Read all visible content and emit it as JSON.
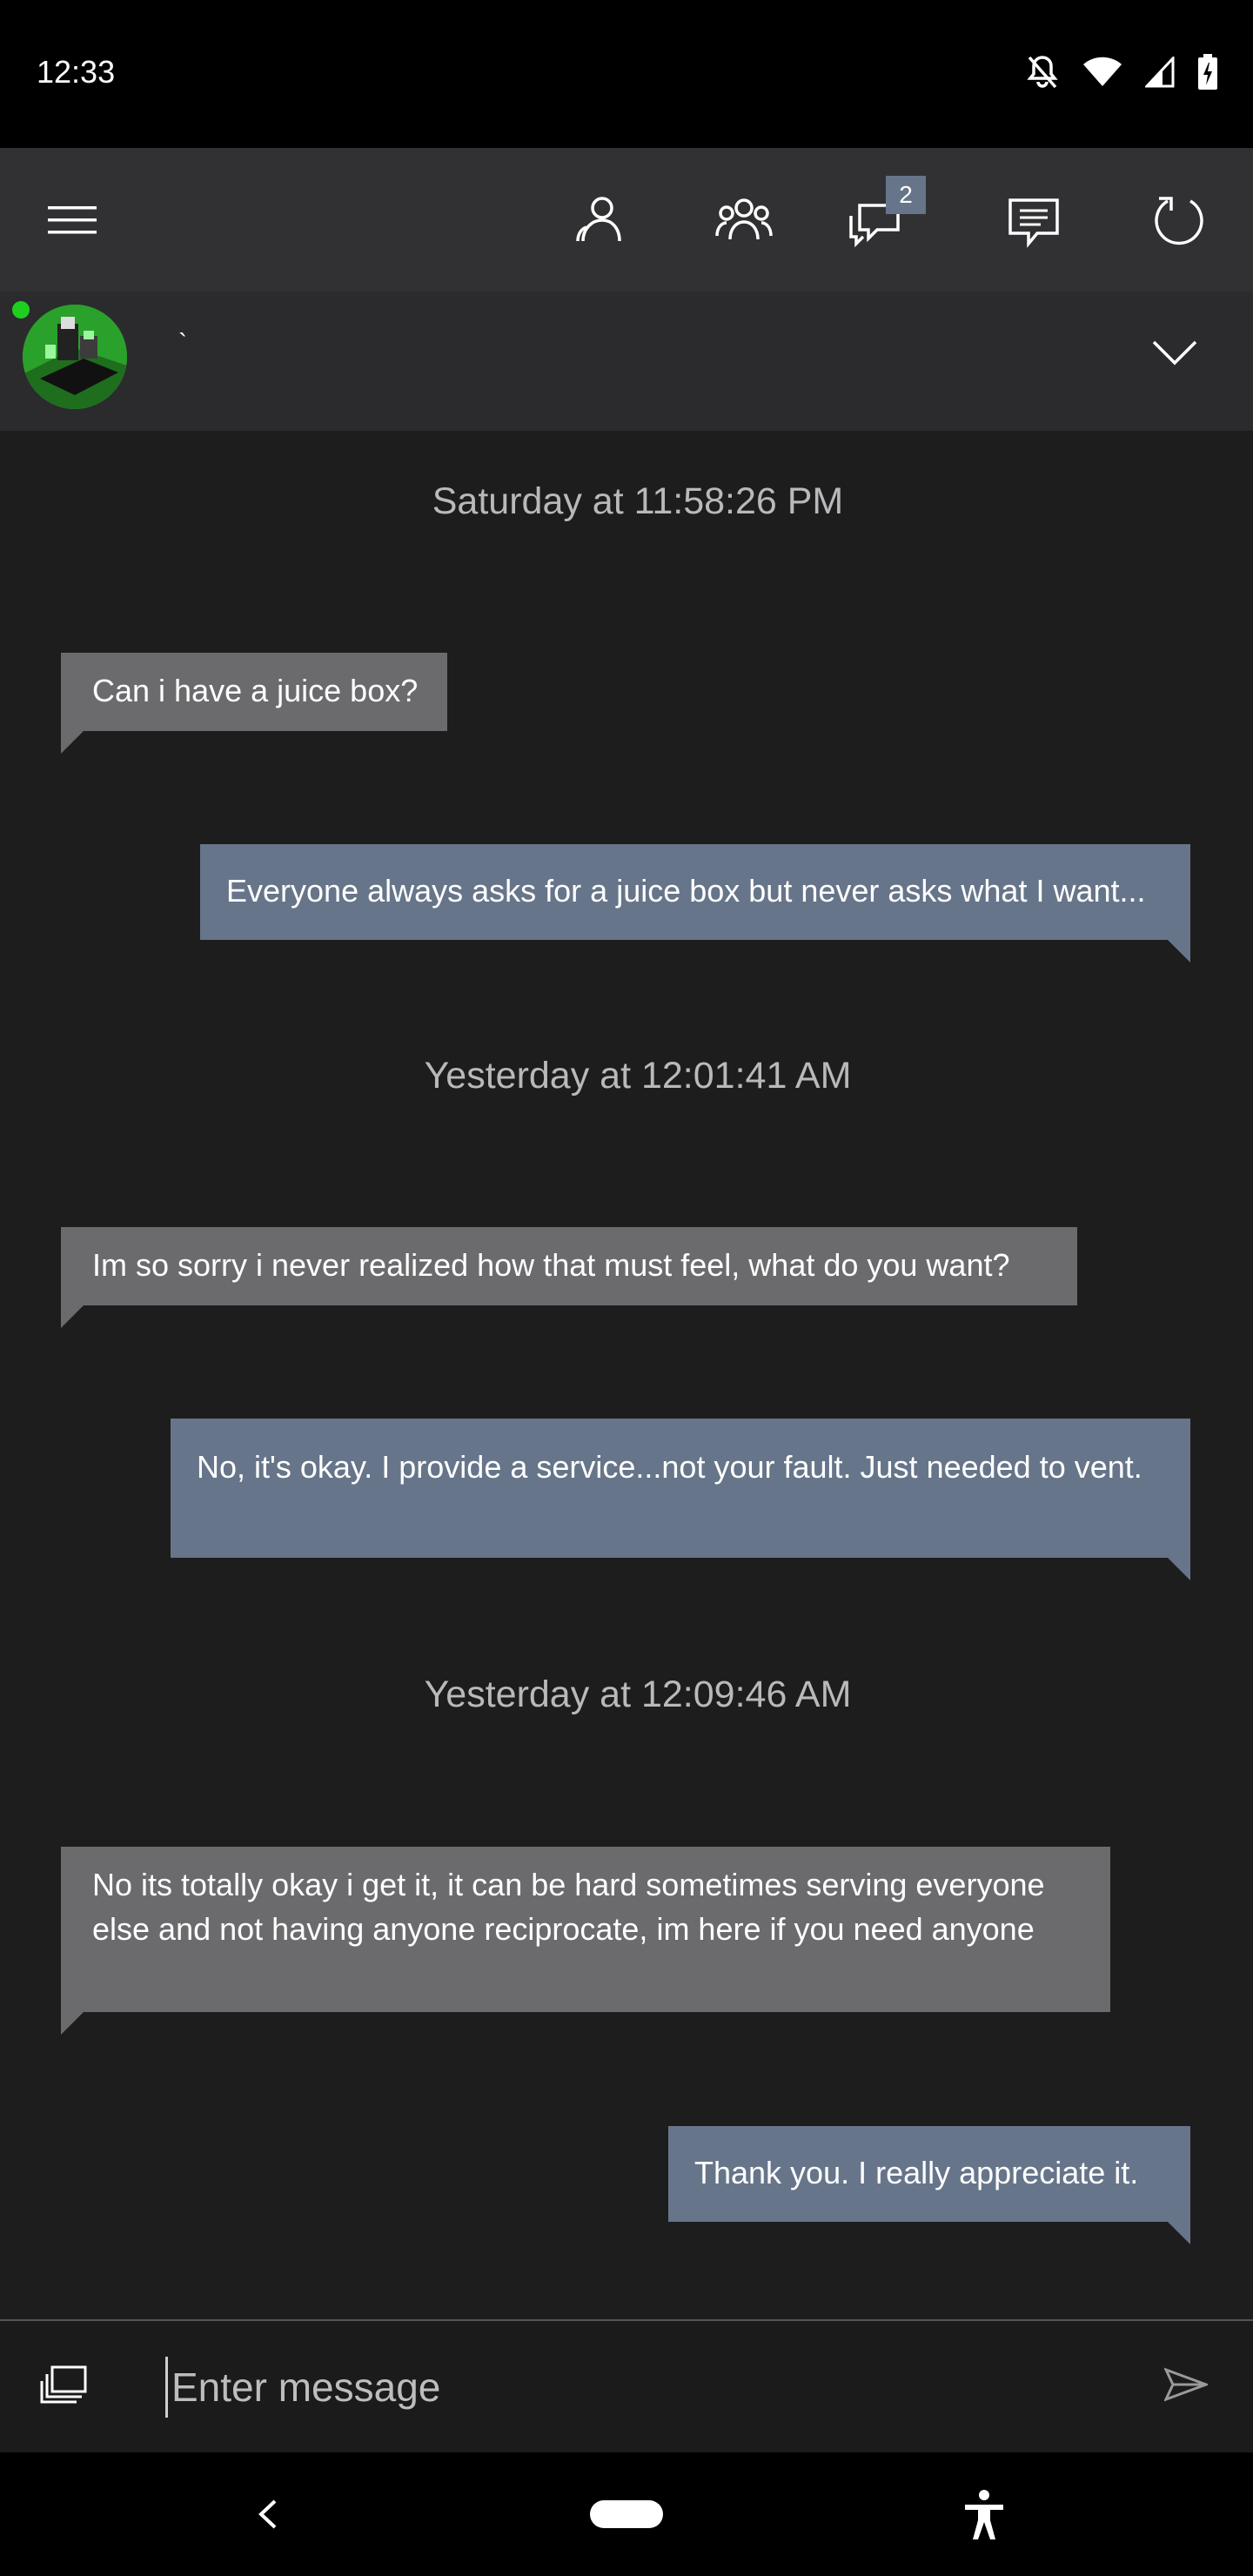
{
  "status_bar": {
    "time": "12:33",
    "icons": [
      "notifications-off-icon",
      "wifi-icon",
      "signal-icon",
      "battery-icon"
    ]
  },
  "toolbar": {
    "icons": [
      "menu-icon",
      "friends-icon",
      "party-icon",
      "conversations-icon",
      "messages-icon",
      "refresh-icon"
    ],
    "conversation_badge": "2"
  },
  "conversation": {
    "contact_name": "`",
    "status": "online",
    "messages": [
      {
        "type": "timestamp",
        "text": "Saturday at 11:58:26 PM"
      },
      {
        "type": "incoming",
        "text": "Can i have a juice box?"
      },
      {
        "type": "outgoing",
        "text": "Everyone always asks for a juice box but never asks what I want..."
      },
      {
        "type": "timestamp",
        "text": "Yesterday at 12:01:41 AM"
      },
      {
        "type": "incoming",
        "text": "Im so sorry i never realized how that must feel, what do you want?"
      },
      {
        "type": "outgoing",
        "text": "No, it's okay.  I provide a service...not your fault.  Just needed to vent."
      },
      {
        "type": "timestamp",
        "text": "Yesterday at 12:09:46 AM"
      },
      {
        "type": "incoming",
        "text": "No its totally okay i get it, it can be hard sometimes serving everyone else and not having anyone reciprocate, im here if you need anyone"
      },
      {
        "type": "outgoing",
        "text": "Thank you.  I really appreciate it."
      }
    ]
  },
  "compose": {
    "placeholder": "Enter message",
    "value": ""
  },
  "colors": {
    "background": "#1d1d1e",
    "toolbar": "#313133",
    "incoming_bubble": "#6b6b6d",
    "outgoing_bubble": "#67758a",
    "online": "#1fcf1f"
  }
}
